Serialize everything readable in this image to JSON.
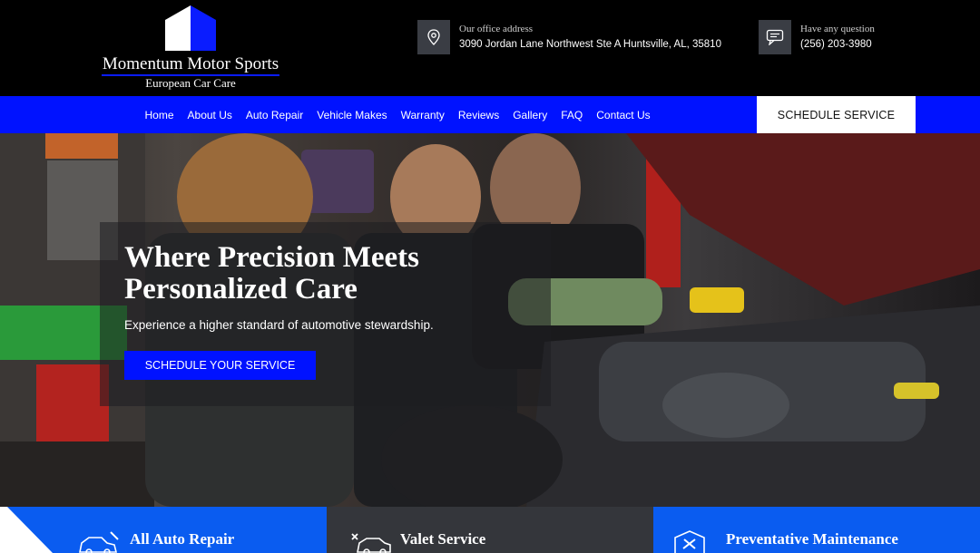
{
  "header": {
    "logo": {
      "name": "Momentum Motor Sports",
      "tagline": "European Car Care"
    },
    "address": {
      "label": "Our office address",
      "value": "3090 Jordan Lane Northwest Ste A Huntsville, AL, 35810",
      "icon": "location-pin-icon"
    },
    "phone": {
      "label": "Have any question",
      "value": "(256) 203-3980",
      "icon": "chat-icon"
    }
  },
  "nav": {
    "items": [
      "Home",
      "About Us",
      "Auto Repair",
      "Vehicle Makes",
      "Warranty",
      "Reviews",
      "Gallery",
      "FAQ",
      "Contact Us"
    ],
    "cta": "SCHEDULE SERVICE"
  },
  "hero": {
    "title": "Where Precision Meets Personalized Care",
    "subtitle": "Experience a higher standard of automotive stewardship.",
    "button": "SCHEDULE YOUR SERVICE"
  },
  "services": [
    {
      "label": "All Auto Repair",
      "icon": "car-repair-icon"
    },
    {
      "label": "Valet Service",
      "icon": "car-valet-icon"
    },
    {
      "label": "Preventative Maintenance",
      "icon": "wrench-shield-icon"
    }
  ],
  "colors": {
    "brand_blue": "#0012ff",
    "tile_blue": "#0a5cf0",
    "tile_dark": "#34363b",
    "header_bg": "#000000"
  }
}
